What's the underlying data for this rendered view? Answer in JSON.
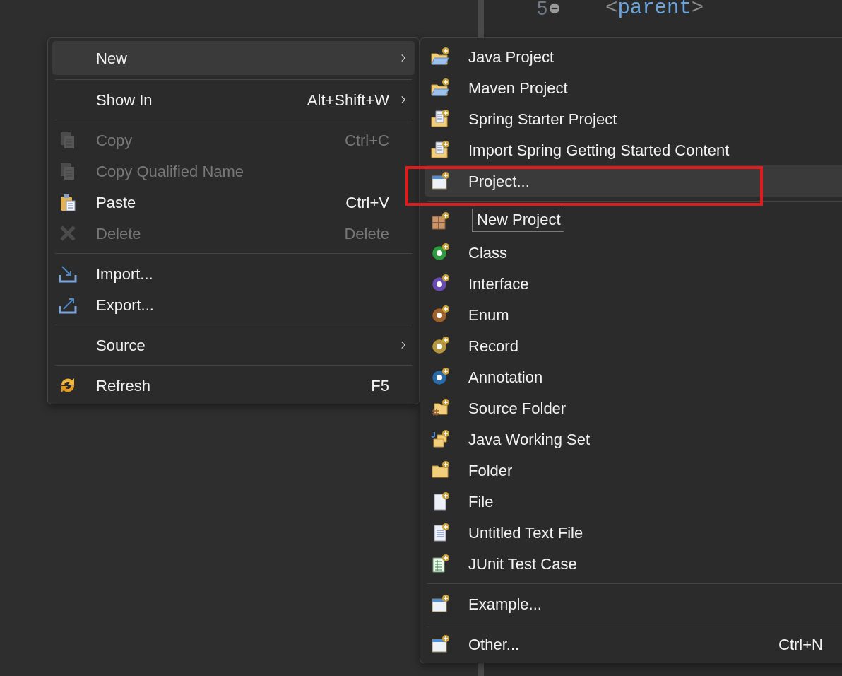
{
  "editor": {
    "lines": [
      {
        "number": "5",
        "collapsible": true,
        "code": [
          {
            "kind": "bracket",
            "text": "<"
          },
          {
            "kind": "tag",
            "text": "parent"
          },
          {
            "kind": "bracket",
            "text": ">"
          }
        ]
      }
    ]
  },
  "context_menu": {
    "groups": [
      [
        {
          "label": "New",
          "submenu": true,
          "disabled": false,
          "selected": true
        }
      ],
      [
        {
          "label": "Show In",
          "shortcut": "Alt+Shift+W",
          "submenu": true,
          "disabled": false,
          "selected": false
        }
      ],
      [
        {
          "label": "Copy",
          "shortcut": "Ctrl+C",
          "submenu": false,
          "disabled": true,
          "selected": false
        },
        {
          "label": "Copy Qualified Name",
          "submenu": false,
          "disabled": true,
          "selected": false
        },
        {
          "label": "Paste",
          "shortcut": "Ctrl+V",
          "submenu": false,
          "disabled": false,
          "selected": false
        },
        {
          "label": "Delete",
          "shortcut": "Delete",
          "submenu": false,
          "disabled": true,
          "selected": false
        }
      ],
      [
        {
          "label": "Import...",
          "submenu": false,
          "disabled": false,
          "selected": false
        },
        {
          "label": "Export...",
          "submenu": false,
          "disabled": false,
          "selected": false
        }
      ],
      [
        {
          "label": "Source",
          "submenu": true,
          "disabled": false,
          "selected": false
        }
      ],
      [
        {
          "label": "Refresh",
          "shortcut": "F5",
          "submenu": false,
          "disabled": false,
          "selected": false
        }
      ]
    ]
  },
  "new_submenu": {
    "groups": [
      [
        {
          "label": "Java Project",
          "selected": false
        },
        {
          "label": "Maven Project",
          "selected": false
        },
        {
          "label": "Spring Starter Project",
          "selected": false
        },
        {
          "label": "Import Spring Getting Started Content",
          "selected": false
        },
        {
          "label": "Project...",
          "selected": true
        }
      ],
      [
        {
          "selected": false
        },
        {
          "label": "Class",
          "selected": false
        },
        {
          "label": "Interface",
          "selected": false
        },
        {
          "label": "Enum",
          "selected": false
        },
        {
          "label": "Record",
          "selected": false
        },
        {
          "label": "Annotation",
          "selected": false
        },
        {
          "label": "Source Folder",
          "selected": false
        },
        {
          "label": "Java Working Set",
          "selected": false
        },
        {
          "label": "Folder",
          "selected": false
        },
        {
          "label": "File",
          "selected": false
        },
        {
          "label": "Untitled Text File",
          "selected": false
        },
        {
          "label": "JUnit Test Case",
          "selected": false
        }
      ],
      [
        {
          "label": "Example...",
          "selected": false
        }
      ],
      [
        {
          "label": "Other...",
          "shortcut": "Ctrl+N",
          "selected": false
        }
      ]
    ]
  },
  "tooltip": {
    "text": "New Project"
  },
  "highlight_box": {
    "shown": true
  }
}
